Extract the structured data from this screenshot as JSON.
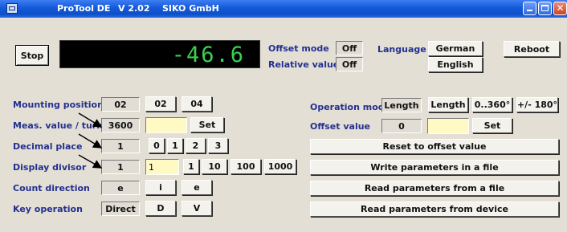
{
  "window": {
    "app_name": "ProTool DE",
    "version": "V 2.02",
    "company": "SIKO GmbH",
    "close_glyph": "✕"
  },
  "top": {
    "stop_label": "Stop",
    "display_value": "-46.6",
    "offset_mode_label": "Offset mode",
    "offset_mode_value": "Off",
    "relative_value_label": "Relative value",
    "relative_value_value": "Off",
    "language_label": "Language",
    "language_options": [
      "German",
      "English"
    ],
    "reboot_label": "Reboot"
  },
  "left_rows": {
    "mounting_position": {
      "label": "Mounting position",
      "current": "02",
      "options": [
        "02",
        "04"
      ]
    },
    "meas_value_turn": {
      "label": "Meas. value / turn",
      "current": "3600",
      "input_value": "",
      "set_label": "Set"
    },
    "decimal_place": {
      "label": "Decimal place",
      "current": "1",
      "options": [
        "0",
        "1",
        "2",
        "3"
      ]
    },
    "display_divisor": {
      "label": "Display divisor",
      "current": "1",
      "input_value": "1",
      "options": [
        "1",
        "10",
        "100",
        "1000"
      ]
    },
    "count_direction": {
      "label": "Count direction",
      "current": "e",
      "options": [
        "i",
        "e"
      ]
    },
    "key_operation": {
      "label": "Key operation",
      "current": "Direct",
      "options": [
        "D",
        "V"
      ]
    }
  },
  "right_rows": {
    "operation_mode": {
      "label": "Operation mode",
      "current": "Length",
      "options": [
        "Length",
        "0..360°",
        "+/- 180°"
      ]
    },
    "offset_value": {
      "label": "Offset value",
      "current": "0",
      "input_value": "",
      "set_label": "Set"
    },
    "actions": [
      "Reset to offset value",
      "Write parameters in a file",
      "Read parameters from a file",
      "Read parameters from device"
    ]
  },
  "colors": {
    "title_bar": "#0d4fc9",
    "display_bg": "#000000",
    "display_text": "#3ccf4e",
    "label_text": "#23308f",
    "input_bg": "#fff9c4",
    "window_bg": "#e3dfd5"
  }
}
